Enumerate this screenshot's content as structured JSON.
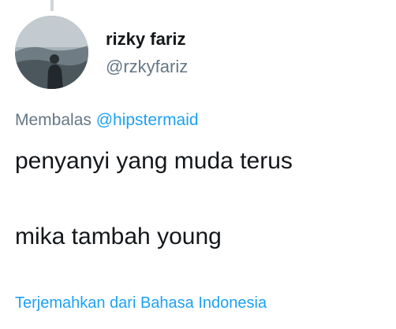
{
  "user": {
    "display_name": "rizky fariz",
    "handle": "@rzkyfariz"
  },
  "reply": {
    "prefix": "Membalas",
    "mention": "@hipstermaid"
  },
  "tweet": {
    "lines": [
      "penyanyi yang muda terus",
      "mika tambah young"
    ]
  },
  "translate_label": "Terjemahkan dari Bahasa Indonesia",
  "colors": {
    "link": "#1da1f2",
    "secondary_text": "#657786",
    "primary_text": "#14171a"
  }
}
